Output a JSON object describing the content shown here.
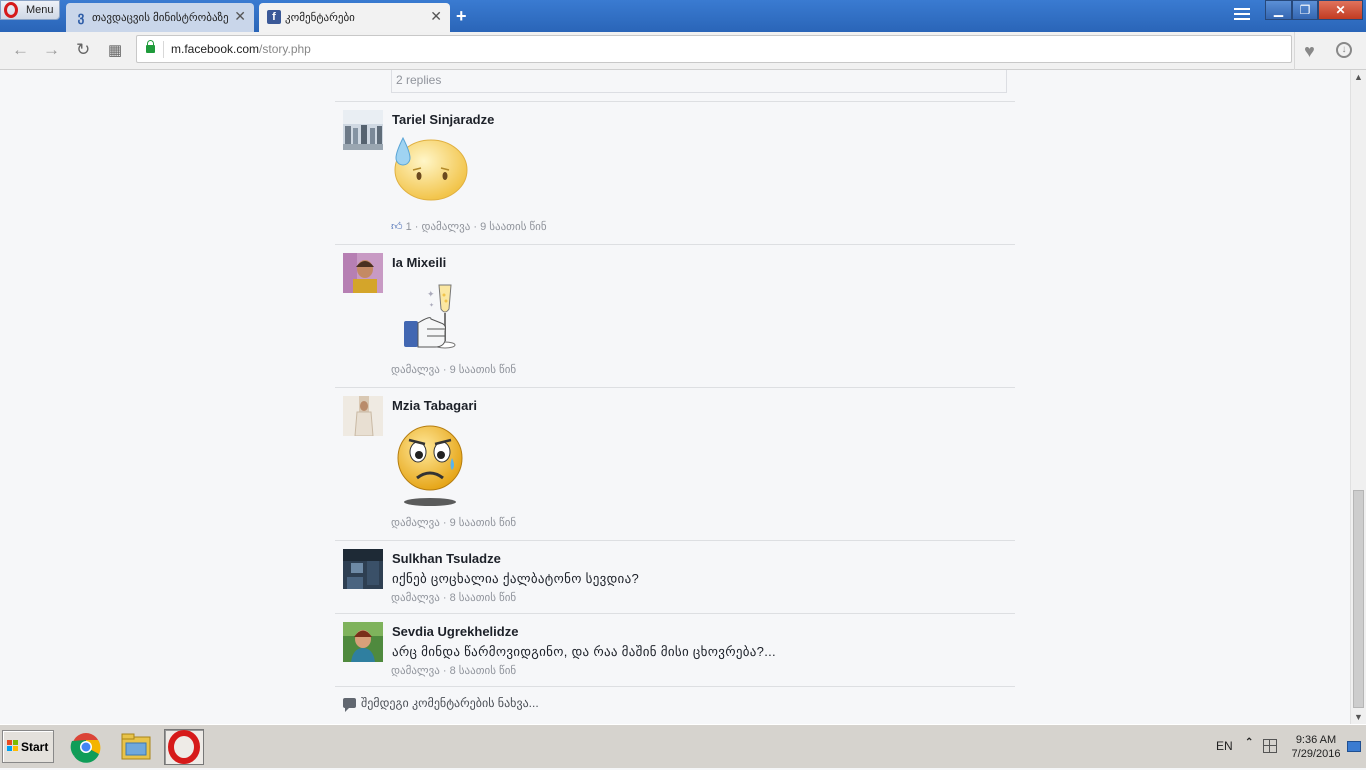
{
  "browser": {
    "menu_label": "Menu",
    "tabs": [
      {
        "title": "თავდაცვის მინისტრობაზე უარი…",
        "icon": "georgian-letter-icon"
      },
      {
        "title": "კომენტარები",
        "icon": "facebook-icon"
      }
    ],
    "new_tab": "+",
    "url_host": "m.facebook.com",
    "url_path": "/story.php"
  },
  "page": {
    "replies_label": "2 replies",
    "comments": [
      {
        "author": "Tariel Sinjaradze",
        "sticker": "sad-sweat-emoji",
        "likes": "1",
        "meta": "დამალვა · 9 საათის წინ"
      },
      {
        "author": "Ia Mixeili",
        "sticker": "thumbs-up-champagne",
        "meta": "დამალვა · 9 საათის წინ"
      },
      {
        "author": "Mzia Tabagari",
        "sticker": "crying-emoji",
        "meta": "დამალვა · 9 საათის წინ"
      },
      {
        "author": "Sulkhan Tsuladze",
        "text": "იქნებ ცოცხალია ქალბატონო სევდია?",
        "meta": "დამალვა · 8 საათის წინ"
      },
      {
        "author": "Sevdia Ugrekhelidze",
        "text": "არც მინდა წარმოვიდგინო, და რაა მაშინ მისი ცხოვრება?...",
        "meta": "დამალვა · 8 საათის წინ"
      }
    ],
    "more_comments": "შემდეგი კომენტარების ნახვა..."
  },
  "taskbar": {
    "start_label": "Start",
    "apps": [
      "chrome-icon",
      "file-manager-icon",
      "opera-icon"
    ],
    "language": "EN",
    "time": "9:36 AM",
    "date": "7/29/2016"
  },
  "colors": {
    "facebook_blue": "#3b5998",
    "titlebar": "#2a65b8",
    "meta_grey": "#90949c"
  }
}
